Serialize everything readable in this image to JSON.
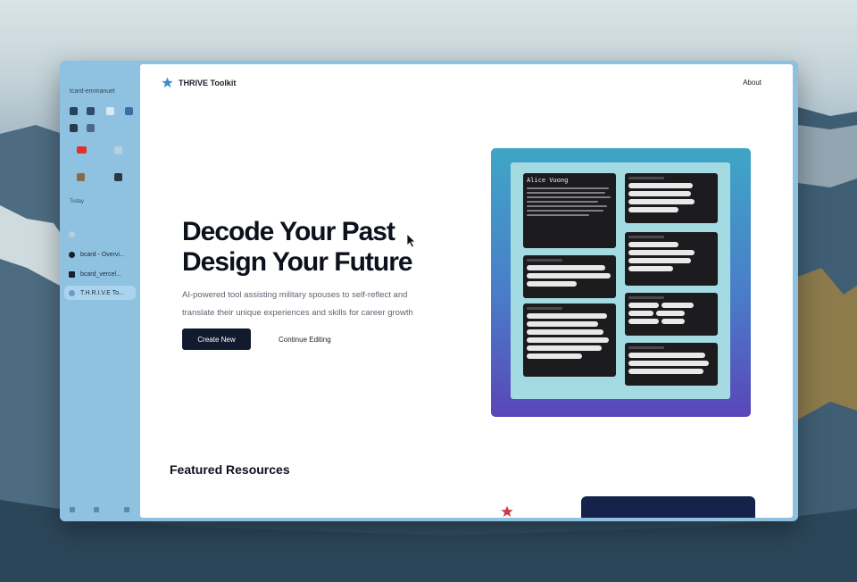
{
  "sidebar": {
    "space_name": "tcard-emmanuel",
    "section_label": "Today",
    "tabs": [
      {
        "label": "",
        "active": false
      },
      {
        "label": "bcard - Overvi...",
        "active": false
      },
      {
        "label": "bcard_vercel...",
        "active": false
      },
      {
        "label": "T.H.R.I.V.E To...",
        "active": true
      }
    ]
  },
  "nav": {
    "brand": "THRIVE Toolkit",
    "about": "About"
  },
  "hero": {
    "title_line1": "Decode Your Past",
    "title_line2": "Design Your Future",
    "subtitle": "AI-powered tool assisting military spouses to self-reflect and translate their unique experiences and skills for career growth",
    "primary_button": "Create New",
    "secondary_button": "Continue Editing"
  },
  "preview": {
    "name": "Alice Vuong"
  },
  "resources": {
    "title": "Featured Resources"
  },
  "colors": {
    "accent_dark": "#121b2e",
    "sidebar_bg": "#8fc1e1",
    "card_grad_top": "#3fa6c6",
    "card_grad_bottom": "#5a46b8"
  }
}
